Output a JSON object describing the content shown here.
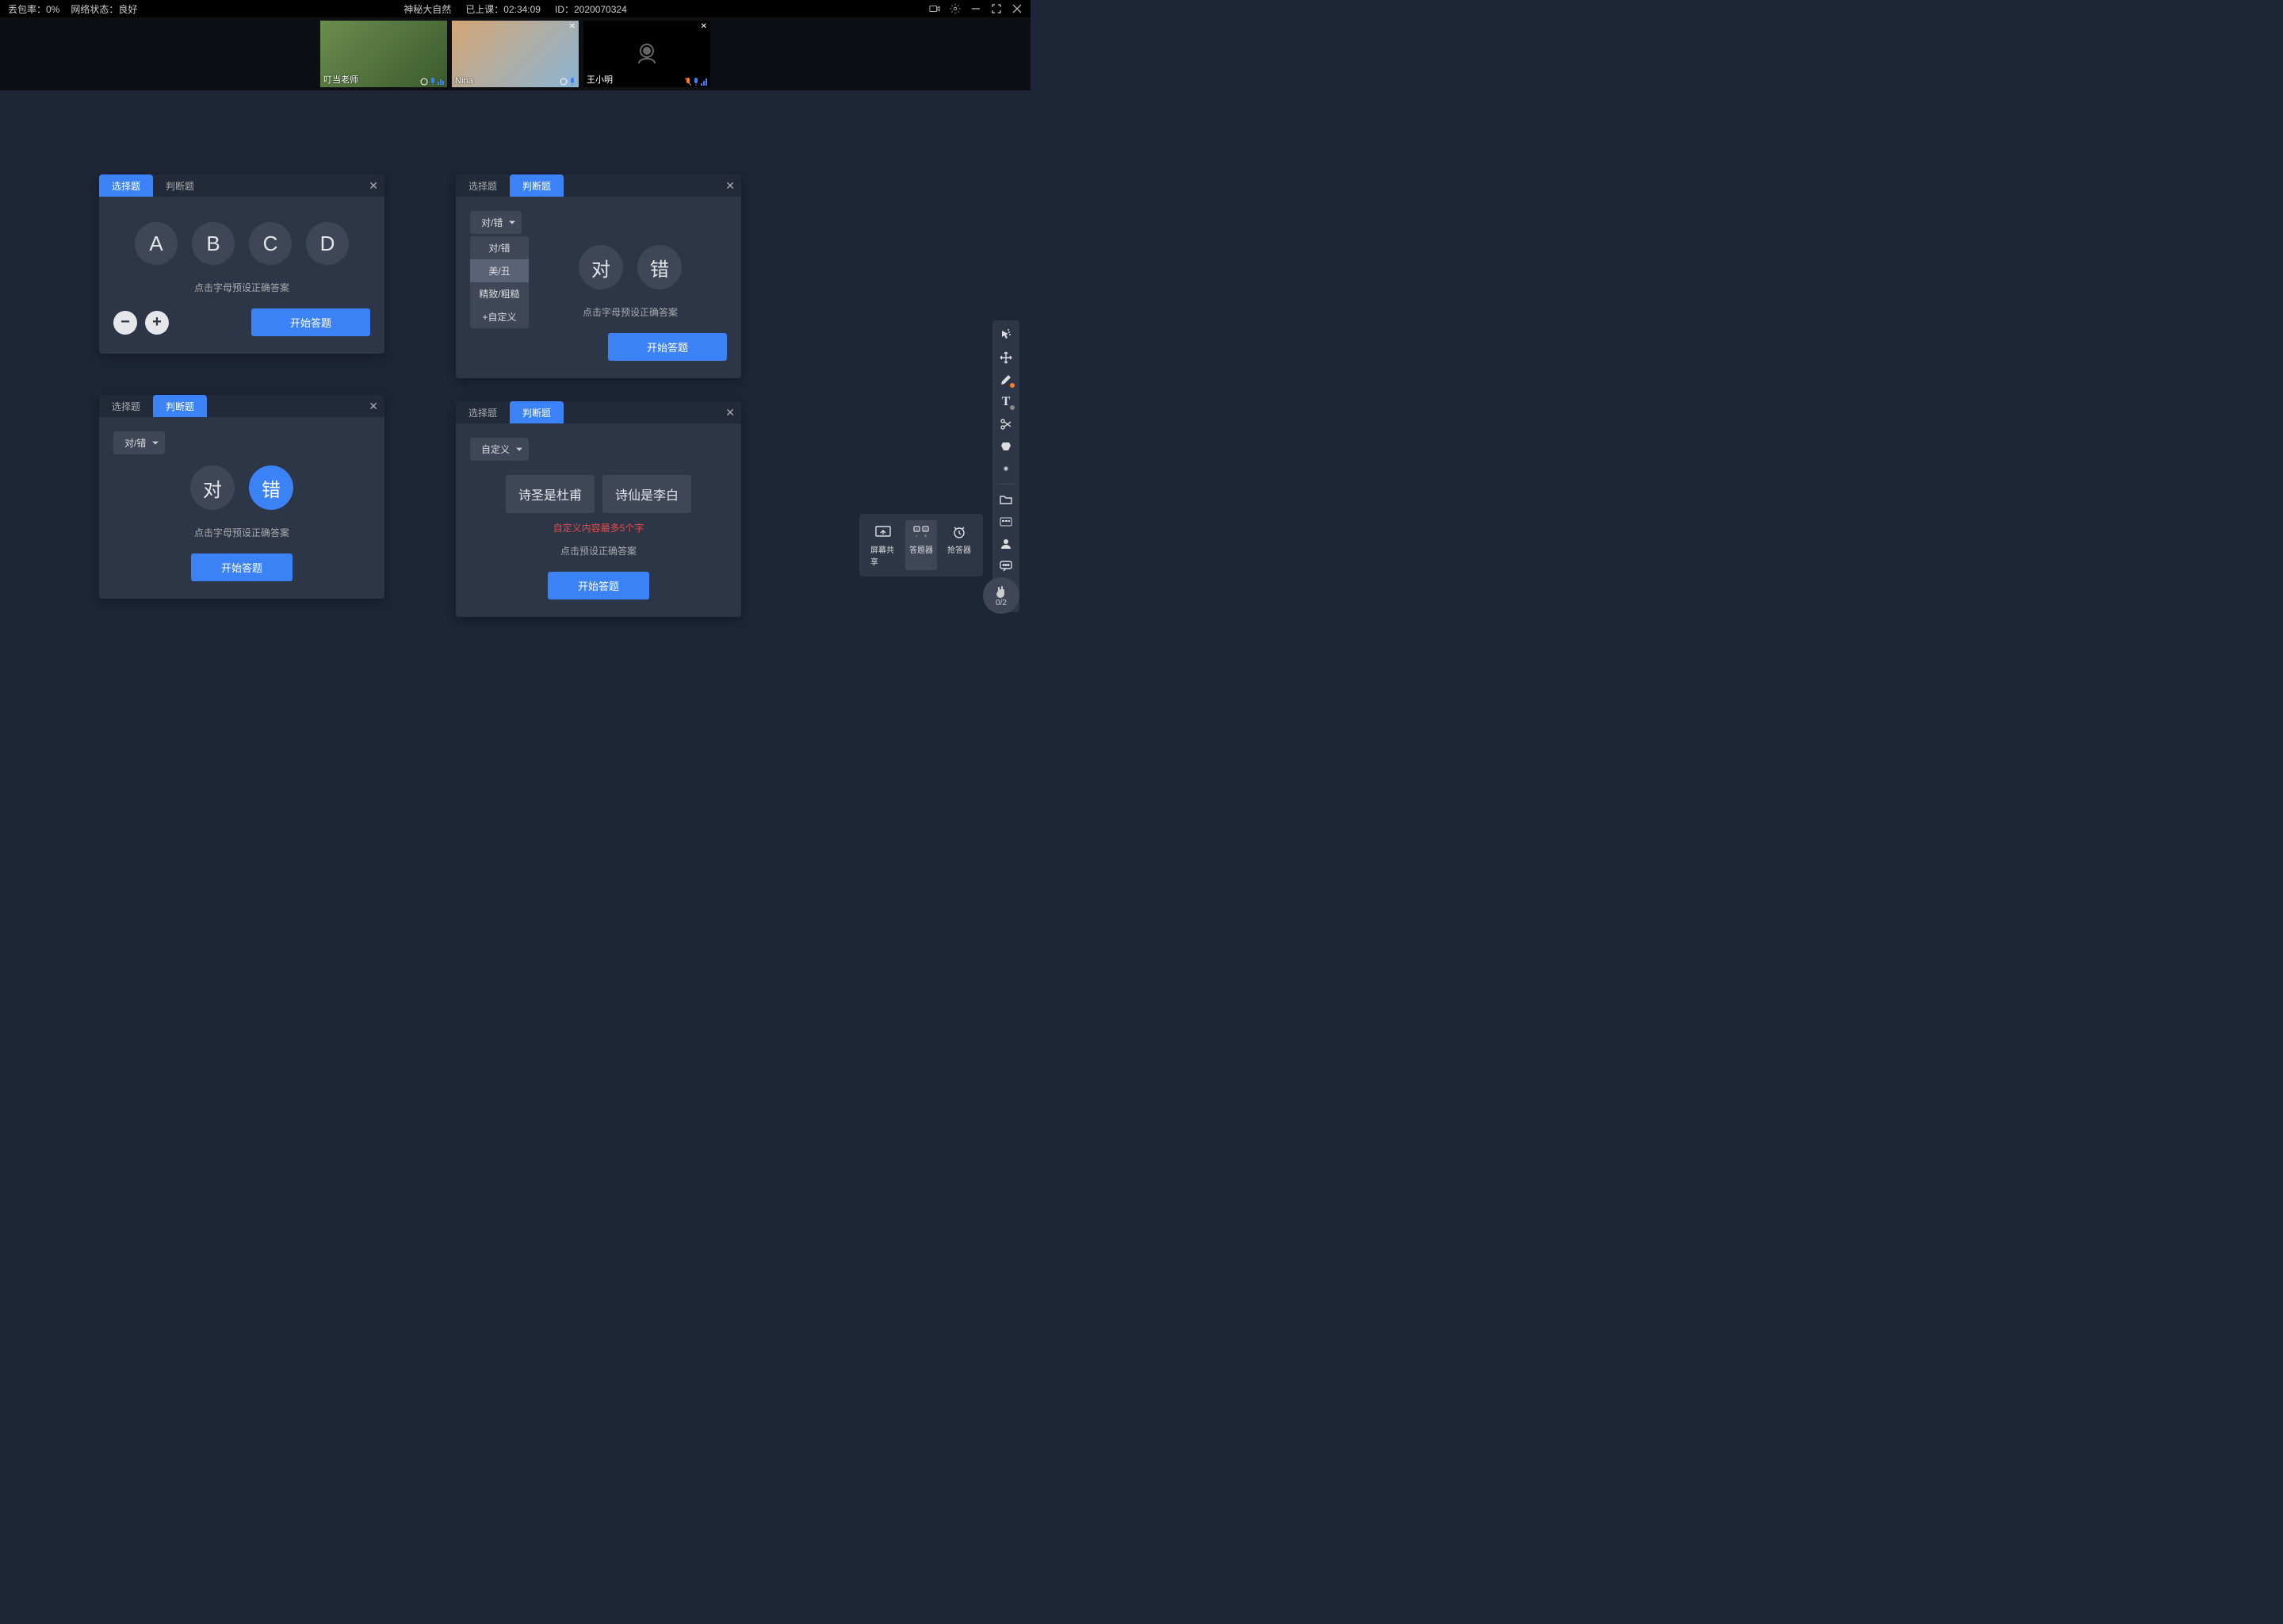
{
  "topbar": {
    "packetLoss": "丢包率：0%",
    "networkStatus": "网络状态：良好",
    "title": "神秘大自然",
    "elapsedLabel": "已上课：",
    "elapsedTime": "02:34:09",
    "idLabel": "ID：",
    "idValue": "2020070324"
  },
  "participants": [
    {
      "name": "叮当老师",
      "hasVideo": true,
      "hasClose": false
    },
    {
      "name": "Nina",
      "hasVideo": true,
      "hasClose": true
    },
    {
      "name": "王小明",
      "hasVideo": false,
      "hasClose": true
    }
  ],
  "panels": {
    "tabs": {
      "choice": "选择题",
      "judgment": "判断题"
    },
    "hint": "点击字母预设正确答案",
    "hint2": "点击预设正确答案",
    "start": "开始答题",
    "letters": [
      "A",
      "B",
      "C",
      "D"
    ],
    "tf": {
      "true": "对",
      "false": "错"
    },
    "dropdown": {
      "tf_label": "对/错",
      "custom_label": "自定义",
      "items": [
        "对/错",
        "美/丑",
        "精致/粗糙",
        "+自定义"
      ]
    },
    "customOptions": [
      "诗圣是杜甫",
      "诗仙是李白"
    ],
    "customError": "自定义内容最多5个字"
  },
  "featurePopup": {
    "screenShare": "屏幕共享",
    "quiz": "答题器",
    "buzzer": "抢答器"
  },
  "handWidget": "0/2"
}
